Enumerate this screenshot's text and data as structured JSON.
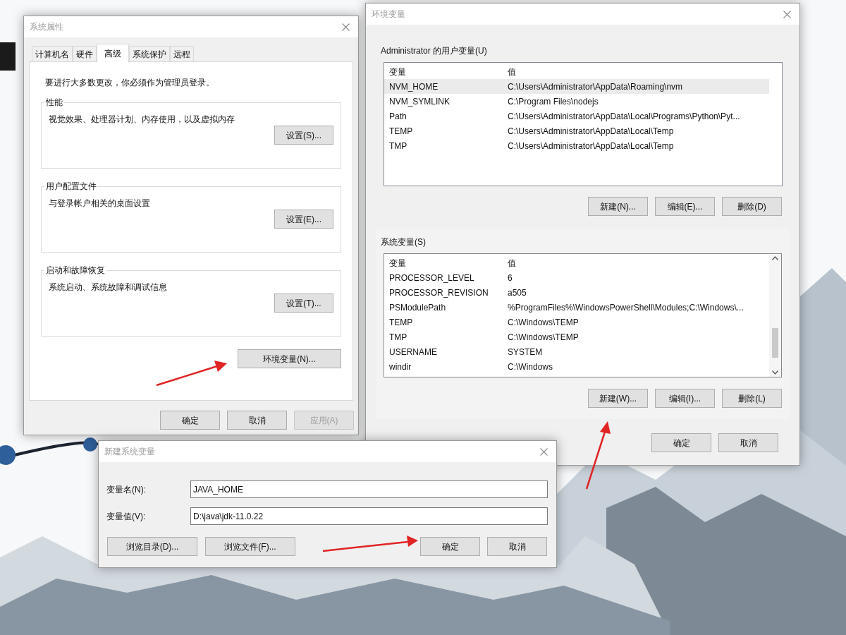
{
  "system_properties": {
    "title": "系统属性",
    "tabs": [
      {
        "label": "计算机名",
        "selected": false
      },
      {
        "label": "硬件",
        "selected": false
      },
      {
        "label": "高级",
        "selected": true
      },
      {
        "label": "系统保护",
        "selected": false
      },
      {
        "label": "远程",
        "selected": false
      }
    ],
    "notice": "要进行大多数更改，你必须作为管理员登录。",
    "groups": [
      {
        "title": "性能",
        "description": "视觉效果、处理器计划、内存使用，以及虚拟内存",
        "button": "设置(S)..."
      },
      {
        "title": "用户配置文件",
        "description": "与登录帐户相关的桌面设置",
        "button": "设置(E)..."
      },
      {
        "title": "启动和故障恢复",
        "description": "系统启动、系统故障和调试信息",
        "button": "设置(T)..."
      }
    ],
    "env_button": "环境变量(N)...",
    "buttons": [
      {
        "label": "确定",
        "disabled": false
      },
      {
        "label": "取消",
        "disabled": false
      },
      {
        "label": "应用(A)",
        "disabled": true
      }
    ]
  },
  "environment_variables": {
    "title": "环境变量",
    "user_variables": {
      "label": "Administrator 的用户变量(U)",
      "columns": [
        "变量",
        "值"
      ],
      "rows": [
        {
          "name": "NVM_HOME",
          "value": "C:\\Users\\Administrator\\AppData\\Roaming\\nvm",
          "selected": true
        },
        {
          "name": "NVM_SYMLINK",
          "value": "C:\\Program Files\\nodejs",
          "selected": false
        },
        {
          "name": "Path",
          "value": "C:\\Users\\Administrator\\AppData\\Local\\Programs\\Python\\Pyt...",
          "selected": false
        },
        {
          "name": "TEMP",
          "value": "C:\\Users\\Administrator\\AppData\\Local\\Temp",
          "selected": false
        },
        {
          "name": "TMP",
          "value": "C:\\Users\\Administrator\\AppData\\Local\\Temp",
          "selected": false
        }
      ],
      "buttons": [
        "新建(N)...",
        "编辑(E)...",
        "删除(D)"
      ]
    },
    "system_variables": {
      "label": "系统变量(S)",
      "columns": [
        "变量",
        "值"
      ],
      "rows": [
        {
          "name": "PROCESSOR_LEVEL",
          "value": "6",
          "selected": false
        },
        {
          "name": "PROCESSOR_REVISION",
          "value": "a505",
          "selected": false
        },
        {
          "name": "PSModulePath",
          "value": "%ProgramFiles%\\WindowsPowerShell\\Modules;C:\\Windows\\...",
          "selected": false
        },
        {
          "name": "TEMP",
          "value": "C:\\Windows\\TEMP",
          "selected": false
        },
        {
          "name": "TMP",
          "value": "C:\\Windows\\TEMP",
          "selected": false
        },
        {
          "name": "USERNAME",
          "value": "SYSTEM",
          "selected": false
        },
        {
          "name": "windir",
          "value": "C:\\Windows",
          "selected": false
        }
      ],
      "buttons": [
        "新建(W)...",
        "编辑(I)...",
        "删除(L)"
      ]
    },
    "buttons": [
      "确定",
      "取消"
    ]
  },
  "new_system_variable": {
    "title": "新建系统变量",
    "fields": [
      {
        "label": "变量名(N):",
        "value": "JAVA_HOME"
      },
      {
        "label": "变量值(V):",
        "value": "D:\\java\\jdk-11.0.22"
      }
    ],
    "browse_buttons": [
      "浏览目录(D)...",
      "浏览文件(F)..."
    ],
    "buttons": [
      "确定",
      "取消"
    ]
  }
}
